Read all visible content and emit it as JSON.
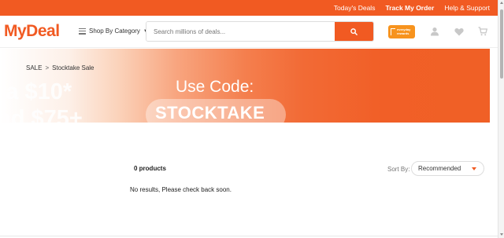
{
  "topbar": {
    "links": [
      "Today's Deals",
      "Track My Order",
      "Help & Support"
    ]
  },
  "header": {
    "logo": "MyDeal",
    "category_menu": "Shop By Category",
    "search": {
      "placeholder": "Search millions of deals...",
      "value": ""
    },
    "badge": {
      "line1": "everyday",
      "line2": "rewards"
    },
    "icons": [
      "account-icon",
      "heart-icon",
      "cart-icon"
    ]
  },
  "colors": {
    "brand": "#f15a22",
    "badge": "#f7931e"
  },
  "breadcrumb": [
    "SALE",
    "Stocktake Sale"
  ],
  "banner": {
    "left_line1": "ra $10*",
    "left_line2": "nd $75+",
    "use_code": "Use Code:",
    "code": "STOCKTAKE"
  },
  "results": {
    "count": "0 products",
    "sort_label": "Sort By:",
    "sort_value": "Recommended",
    "empty_message": "No results, Please check back soon."
  }
}
